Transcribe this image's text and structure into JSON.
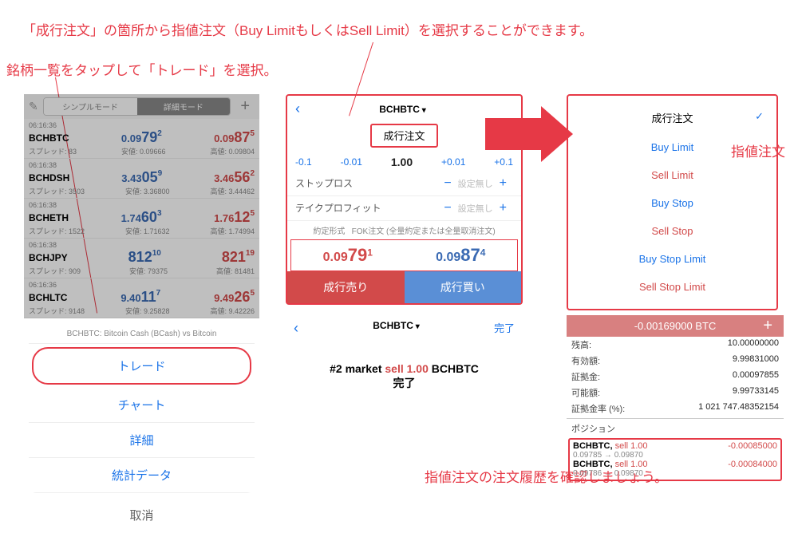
{
  "annotations": {
    "top1": "「成行注文」の箇所から指値注文（Buy LimitもしくはSell Limit）を選択することができます。",
    "top2": "銘柄一覧をタップして「トレード」を選択。",
    "side": "指値注文",
    "bottom": "指値注文の注文履歴を確認しましょう。"
  },
  "left": {
    "simple": "シンプルモード",
    "detail": "詳細モード",
    "symbols": [
      {
        "time": "06:16:36",
        "name": "BCHBTC",
        "bid": "0.09",
        "bid_big": "79",
        "bid_sup": "2",
        "ask": "0.09",
        "ask_big": "87",
        "ask_sup": "5",
        "spread": "スプレッド: 83",
        "low": "安値: 0.09666",
        "high": "高値: 0.09804"
      },
      {
        "time": "06:16:38",
        "name": "BCHDSH",
        "bid": "3.43",
        "bid_big": "05",
        "bid_sup": "9",
        "ask": "3.46",
        "ask_big": "56",
        "ask_sup": "2",
        "spread": "スプレッド: 3503",
        "low": "安値: 3.36800",
        "high": "高値: 3.44462"
      },
      {
        "time": "06:16:38",
        "name": "BCHETH",
        "bid": "1.74",
        "bid_big": "60",
        "bid_sup": "3",
        "ask": "1.76",
        "ask_big": "12",
        "ask_sup": "5",
        "spread": "スプレッド: 1522",
        "low": "安値: 1.71632",
        "high": "高値: 1.74994"
      },
      {
        "time": "06:16:38",
        "name": "BCHJPY",
        "bid": "",
        "bid_big": "812",
        "bid_sup": "10",
        "ask": "",
        "ask_big": "821",
        "ask_sup": "19",
        "spread": "スプレッド: 909",
        "low": "安値: 79375",
        "high": "高値: 81481"
      },
      {
        "time": "06:16:36",
        "name": "BCHLTC",
        "bid": "9.40",
        "bid_big": "11",
        "bid_sup": "7",
        "ask": "9.49",
        "ask_big": "26",
        "ask_sup": "5",
        "spread": "スプレッド: 9148",
        "low": "安値: 9.25828",
        "high": "高値: 9.42226"
      }
    ],
    "sheet_title": "BCHBTC: Bitcoin Cash (BCash) vs Bitcoin",
    "sheet_trade": "トレード",
    "sheet_chart": "チャート",
    "sheet_detail": "詳細",
    "sheet_stats": "統計データ",
    "sheet_cancel": "取消"
  },
  "order": {
    "symbol": "BCHBTC",
    "type_label": "成行注文",
    "vol": "1.00",
    "dec1": "-0.1",
    "dec01": "-0.01",
    "inc01": "+0.01",
    "inc1": "+0.1",
    "sl_label": "ストップロス",
    "tp_label": "テイクプロフィット",
    "notset": "設定無し",
    "fok_label": "約定形式",
    "fok_text": "FOK注文 (全量約定または全量取消注文)",
    "sell_price": "0.09791",
    "buy_price": "0.09874",
    "sell_btn": "成行売り",
    "buy_btn": "成行買い"
  },
  "done": {
    "symbol": "BCHBTC",
    "done": "完了",
    "line1_pre": "#2 market ",
    "line1_op": "sell 1.00",
    "line1_post": " BCHBTC",
    "line2": "完了"
  },
  "otype": {
    "market": "成行注文",
    "buy_limit": "Buy Limit",
    "sell_limit": "Sell Limit",
    "buy_stop": "Buy Stop",
    "sell_stop": "Sell Stop",
    "buy_stop_limit": "Buy Stop Limit",
    "sell_stop_limit": "Sell Stop Limit"
  },
  "trade": {
    "pnl": "-0.00169000 BTC",
    "balance_l": "残高:",
    "balance_v": "10.00000000",
    "equity_l": "有効額:",
    "equity_v": "9.99831000",
    "margin_l": "証拠金:",
    "margin_v": "0.00097855",
    "free_l": "可能額:",
    "free_v": "9.99733145",
    "level_l": "証拠金率 (%):",
    "level_v": "1 021 747.48352154",
    "pos_h": "ポジション",
    "pos": [
      {
        "sym": "BCHBTC,",
        "op": "sell 1.00",
        "pnl": "-0.00085000",
        "detail": "0.09785 → 0.09870"
      },
      {
        "sym": "BCHBTC,",
        "op": "sell 1.00",
        "pnl": "-0.00084000",
        "detail": "0.09786 → 0.09870"
      }
    ]
  }
}
